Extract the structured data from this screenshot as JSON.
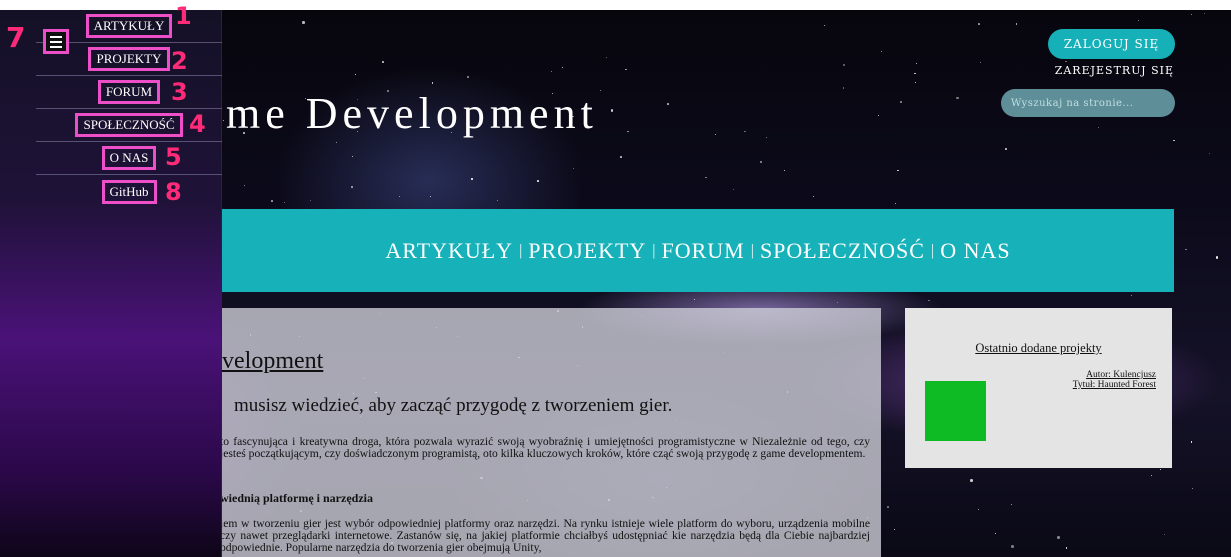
{
  "sidebar": {
    "items": [
      {
        "label": "ARTYKUŁY",
        "annotation": "1"
      },
      {
        "label": "PROJEKTY",
        "annotation": "2"
      },
      {
        "label": "FORUM",
        "annotation": "3"
      },
      {
        "label": "SPOŁECZNOŚĆ",
        "annotation": "4"
      },
      {
        "label": "O NAS",
        "annotation": "5"
      },
      {
        "label": "GitHub",
        "annotation": "8"
      }
    ],
    "menu_annotation": "7",
    "menu_icon": "hamburger-menu-icon"
  },
  "header": {
    "site_title": "me Development",
    "login_label": "ZALOGUJ SIĘ",
    "register_label": "ZAREJESTRUJ SIĘ",
    "search_placeholder": "Wyszukaj na stronie..."
  },
  "nav": {
    "links": [
      "ARTYKUŁY",
      "PROJEKTY",
      "FORUM",
      "SPOŁECZNOŚĆ",
      "O NAS"
    ],
    "separator": "|"
  },
  "article": {
    "title": "velopment",
    "subtitle": "musisz wiedzieć, aby zacząć przygodę z tworzeniem gier.",
    "paragraph1": "to fascynująca i kreatywna droga, która pozwala wyrazić swoją wyobraźnię i umiejętności programistyczne w Niezależnie od tego, czy jesteś początkującym, czy doświadczonym programistą, oto kilka kluczowych kroków, które cząć swoją przygodę z game developmentem.",
    "heading": "wiednią platformę i narzędzia",
    "paragraph2": "iem w tworzeniu gier jest wybór odpowiedniej platformy oraz narzędzi. Na rynku istnieje wiele platform do wyboru, urządzenia mobilne czy nawet przeglądarki internetowe. Zastanów się, na jakiej platformie chciałbyś udostępniać kie narzędzia będą dla Ciebie najbardziej odpowiednie. Popularne narzędzia do tworzenia gier obejmują Unity,"
  },
  "recent": {
    "title": "Ostatnio dodane projekty",
    "author": "Autor: Kulencjusz",
    "project_title": "Tytuł: Haunted Forest",
    "thumb_color": "#0fbb25"
  },
  "colors": {
    "accent_teal": "#17b1b9",
    "annotation_pink": "#ec4fc8",
    "annotation_red": "#ff2a78"
  }
}
